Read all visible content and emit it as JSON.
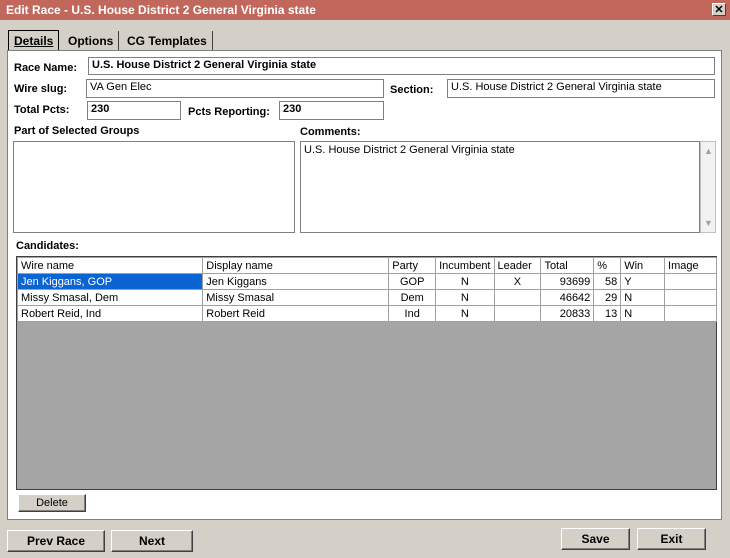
{
  "window": {
    "title": "Edit Race - U.S. House District 2 General Virginia state",
    "close_glyph": "✕"
  },
  "tabs": [
    {
      "label": "Details",
      "active": true
    },
    {
      "label": "Options",
      "active": false
    },
    {
      "label": "CG Templates",
      "active": false
    }
  ],
  "form": {
    "race_name_label": "Race Name:",
    "race_name_value": "U.S. House District 2 General Virginia state",
    "wire_slug_label": "Wire slug:",
    "wire_slug_value": "VA Gen Elec",
    "section_label": "Section:",
    "section_value": "U.S. House District 2 General Virginia state",
    "total_pcts_label": "Total Pcts:",
    "total_pcts_value": "230",
    "pcts_reporting_label": "Pcts Reporting:",
    "pcts_reporting_value": "230",
    "groups_label": "Part of Selected Groups",
    "comments_label": "Comments:",
    "comments_value": "U.S. House District 2 General Virginia state",
    "candidates_label": "Candidates:"
  },
  "candidates": {
    "columns": [
      "Wire name",
      "Display name",
      "Party",
      "Incumbent",
      "Leader",
      "Total",
      "%",
      "Win",
      "Image"
    ],
    "rows": [
      {
        "wire_name": "Jen Kiggans, GOP",
        "display_name": "Jen  Kiggans",
        "party": "GOP",
        "incumbent": "N",
        "leader": "X",
        "total": "93699",
        "pct": "58",
        "win": "Y",
        "image": ""
      },
      {
        "wire_name": "Missy Smasal, Dem",
        "display_name": "Missy  Smasal",
        "party": "Dem",
        "incumbent": "N",
        "leader": "",
        "total": "46642",
        "pct": "29",
        "win": "N",
        "image": ""
      },
      {
        "wire_name": "Robert Reid, Ind",
        "display_name": "Robert  Reid",
        "party": "Ind",
        "incumbent": "N",
        "leader": "",
        "total": "20833",
        "pct": "13",
        "win": "N",
        "image": ""
      }
    ]
  },
  "buttons": {
    "delete": "Delete",
    "prev_race": "Prev Race",
    "next": "Next",
    "save": "Save",
    "exit": "Exit"
  },
  "colors": {
    "titlebar": "#c2675b",
    "selection": "#0a64d2",
    "dialog": "#d4d0c8",
    "grid_empty": "#a5a5a5"
  }
}
